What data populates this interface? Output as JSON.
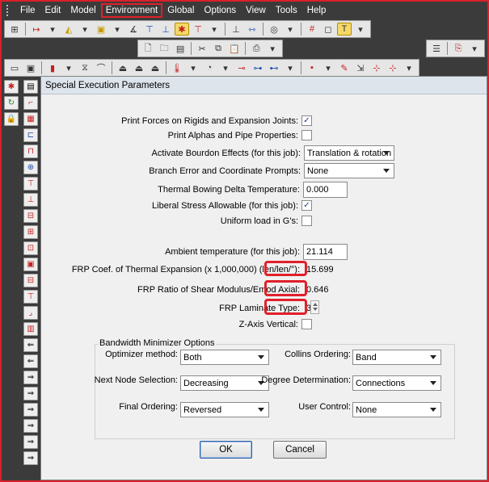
{
  "menubar": {
    "items": [
      "File",
      "Edit",
      "Model",
      "Environment",
      "Global",
      "Options",
      "View",
      "Tools",
      "Help"
    ],
    "active_index": 3
  },
  "dialog": {
    "title": "Special Execution Parameters",
    "fields": {
      "print_forces": {
        "label": "Print Forces on Rigids and Expansion Joints:",
        "checked": true
      },
      "print_alphas": {
        "label": "Print Alphas and Pipe Properties:",
        "checked": false
      },
      "bourdon": {
        "label": "Activate Bourdon Effects (for this job):",
        "value": "Translation & rotation"
      },
      "branch_error": {
        "label": "Branch Error and Coordinate Prompts:",
        "value": "None"
      },
      "thermal_bowing": {
        "label": "Thermal Bowing Delta Temperature:",
        "value": "0.000"
      },
      "liberal_stress": {
        "label": "Liberal Stress Allowable (for this job):",
        "checked": true
      },
      "uniform_load": {
        "label": "Uniform load in G's:",
        "checked": false
      },
      "ambient_temp": {
        "label": "Ambient temperature (for this job):",
        "value": "21.114"
      },
      "frp_coef": {
        "label": "FRP Coef. of Thermal Expansion (x 1,000,000) (len/len/°):",
        "value": "15.699"
      },
      "frp_ratio": {
        "label": "FRP Ratio of Shear Modulus/Emod Axial:",
        "value": "0.646"
      },
      "frp_laminate": {
        "label": "FRP Laminate Type:",
        "value": "3"
      },
      "z_axis": {
        "label": "Z-Axis Vertical:",
        "checked": false
      }
    },
    "bandwidth": {
      "title": "Bandwidth Minimizer Options",
      "optimizer_method": {
        "label": "Optimizer method:",
        "value": "Both"
      },
      "collins_ordering": {
        "label": "Collins Ordering:",
        "value": "Band"
      },
      "next_node": {
        "label": "Next Node Selection:",
        "value": "Decreasing"
      },
      "degree_determination": {
        "label": "Degree Determination:",
        "value": "Connections"
      },
      "final_ordering": {
        "label": "Final Ordering:",
        "value": "Reversed"
      },
      "user_control": {
        "label": "User Control:",
        "value": "None"
      }
    },
    "buttons": {
      "ok": "OK",
      "cancel": "Cancel"
    }
  },
  "colors": {
    "highlight": "#e0202a",
    "toolbar": "#3b3b3b"
  }
}
